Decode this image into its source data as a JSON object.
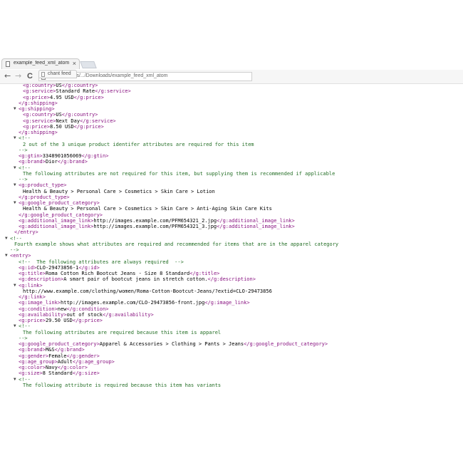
{
  "browser": {
    "tab_title": "example_feed_xml_atom",
    "close_glyph": "×",
    "back_glyph": "←",
    "forward_glyph": "→",
    "reload_glyph": "C",
    "url_fragment": "file:///C:/Users/.../Downloads/example_feed_xml_atom",
    "overlay_tab_title": "chant feed"
  },
  "xml_lines": [
    {
      "indent": 5,
      "arrow": false,
      "segs": [
        [
          "t",
          "<g:country>"
        ],
        [
          "x",
          "US"
        ],
        [
          "t",
          "</g:country>"
        ]
      ]
    },
    {
      "indent": 5,
      "arrow": false,
      "segs": [
        [
          "t",
          "<g:service>"
        ],
        [
          "x",
          "Standard Rate"
        ],
        [
          "t",
          "</g:service>"
        ]
      ]
    },
    {
      "indent": 5,
      "arrow": false,
      "segs": [
        [
          "t",
          "<g:price>"
        ],
        [
          "x",
          "4.95 USD"
        ],
        [
          "t",
          "</g:price>"
        ]
      ]
    },
    {
      "indent": 4,
      "arrow": false,
      "segs": [
        [
          "t",
          "</g:shipping>"
        ]
      ]
    },
    {
      "indent": 4,
      "arrow": true,
      "segs": [
        [
          "t",
          "<g:shipping>"
        ]
      ]
    },
    {
      "indent": 5,
      "arrow": false,
      "segs": [
        [
          "t",
          "<g:country>"
        ],
        [
          "x",
          "US"
        ],
        [
          "t",
          "</g:country>"
        ]
      ]
    },
    {
      "indent": 5,
      "arrow": false,
      "segs": [
        [
          "t",
          "<g:service>"
        ],
        [
          "x",
          "Next Day"
        ],
        [
          "t",
          "</g:service>"
        ]
      ]
    },
    {
      "indent": 5,
      "arrow": false,
      "segs": [
        [
          "t",
          "<g:price>"
        ],
        [
          "x",
          "8.50 USD"
        ],
        [
          "t",
          "</g:price>"
        ]
      ]
    },
    {
      "indent": 4,
      "arrow": false,
      "segs": [
        [
          "t",
          "</g:shipping>"
        ]
      ]
    },
    {
      "indent": 4,
      "arrow": true,
      "segs": [
        [
          "c",
          "<!--"
        ]
      ]
    },
    {
      "indent": 5,
      "arrow": false,
      "segs": [
        [
          "c",
          "2 out of the 3 unique product identifer attributes are required for this item"
        ]
      ]
    },
    {
      "indent": 4,
      "arrow": false,
      "segs": [
        [
          "c",
          "-->"
        ]
      ]
    },
    {
      "indent": 4,
      "arrow": false,
      "segs": [
        [
          "t",
          "<g:gtin>"
        ],
        [
          "x",
          "3348901056069"
        ],
        [
          "t",
          "</g:gtin>"
        ]
      ]
    },
    {
      "indent": 4,
      "arrow": false,
      "segs": [
        [
          "t",
          "<g:brand>"
        ],
        [
          "x",
          "Dior"
        ],
        [
          "t",
          "</g:brand>"
        ]
      ]
    },
    {
      "indent": 4,
      "arrow": true,
      "segs": [
        [
          "c",
          "<!--"
        ]
      ]
    },
    {
      "indent": 5,
      "arrow": false,
      "segs": [
        [
          "c",
          "The following attributes are not required for this item, but supplying them is recommended if applicable"
        ]
      ]
    },
    {
      "indent": 4,
      "arrow": false,
      "segs": [
        [
          "c",
          "-->"
        ]
      ]
    },
    {
      "indent": 4,
      "arrow": true,
      "segs": [
        [
          "t",
          "<g:product_type>"
        ]
      ]
    },
    {
      "indent": 5,
      "arrow": false,
      "segs": [
        [
          "x",
          "Health & Beauty > Personal Care > Cosmetics > Skin Care > Lotion"
        ]
      ]
    },
    {
      "indent": 4,
      "arrow": false,
      "segs": [
        [
          "t",
          "</g:product_type>"
        ]
      ]
    },
    {
      "indent": 4,
      "arrow": true,
      "segs": [
        [
          "t",
          "<g:google_product_category>"
        ]
      ]
    },
    {
      "indent": 5,
      "arrow": false,
      "segs": [
        [
          "x",
          "Health & Beauty > Personal Care > Cosmetics > Skin Care > Anti-Aging Skin Care Kits"
        ]
      ]
    },
    {
      "indent": 4,
      "arrow": false,
      "segs": [
        [
          "t",
          "</g:google_product_category>"
        ]
      ]
    },
    {
      "indent": 4,
      "arrow": false,
      "segs": [
        [
          "t",
          "<g:additional_image_link>"
        ],
        [
          "x",
          "http://images.example.com/PFM654321_2.jpg"
        ],
        [
          "t",
          "</g:additional_image_link>"
        ]
      ]
    },
    {
      "indent": 4,
      "arrow": false,
      "segs": [
        [
          "t",
          "<g:additional_image_link>"
        ],
        [
          "x",
          "http://images.example.com/PFM654321_3.jpg"
        ],
        [
          "t",
          "</g:additional_image_link>"
        ]
      ]
    },
    {
      "indent": 3,
      "arrow": false,
      "segs": [
        [
          "t",
          "</entry>"
        ]
      ]
    },
    {
      "indent": 2,
      "arrow": true,
      "segs": [
        [
          "c",
          "<!--"
        ]
      ]
    },
    {
      "indent": 3,
      "arrow": false,
      "segs": [
        [
          "c",
          "Fourth example shows what attributes are required and recommended for items that are in the apparel category"
        ]
      ]
    },
    {
      "indent": 2,
      "arrow": false,
      "segs": [
        [
          "c",
          "-->"
        ]
      ]
    },
    {
      "indent": 2,
      "arrow": true,
      "segs": [
        [
          "t",
          "<entry>"
        ]
      ]
    },
    {
      "indent": 4,
      "arrow": false,
      "segs": [
        [
          "c",
          "<!--  The following attributes are always required  -->"
        ]
      ]
    },
    {
      "indent": 4,
      "arrow": false,
      "segs": [
        [
          "t",
          "<g:id>"
        ],
        [
          "x",
          "CLO-29473856-1"
        ],
        [
          "t",
          "</g:id>"
        ]
      ]
    },
    {
      "indent": 4,
      "arrow": false,
      "segs": [
        [
          "t",
          "<g:title>"
        ],
        [
          "x",
          "Roma Cotton Rich Bootcut Jeans - Size 8 Standard"
        ],
        [
          "t",
          "</g:title>"
        ]
      ]
    },
    {
      "indent": 4,
      "arrow": false,
      "segs": [
        [
          "t",
          "<g:description>"
        ],
        [
          "x",
          "A smart pair of bootcut jeans in stretch cotton."
        ],
        [
          "t",
          "</g:description>"
        ]
      ]
    },
    {
      "indent": 4,
      "arrow": true,
      "segs": [
        [
          "t",
          "<g:link>"
        ]
      ]
    },
    {
      "indent": 5,
      "arrow": false,
      "segs": [
        [
          "x",
          "http://www.example.com/clothing/women/Roma-Cotton-Bootcut-Jeans/?extid=CLO-29473856"
        ]
      ]
    },
    {
      "indent": 4,
      "arrow": false,
      "segs": [
        [
          "t",
          "</g:link>"
        ]
      ]
    },
    {
      "indent": 4,
      "arrow": false,
      "segs": [
        [
          "t",
          "<g:image_link>"
        ],
        [
          "x",
          "http://images.example.com/CLO-29473856-front.jpg"
        ],
        [
          "t",
          "</g:image_link>"
        ]
      ]
    },
    {
      "indent": 4,
      "arrow": false,
      "segs": [
        [
          "t",
          "<g:condition>"
        ],
        [
          "x",
          "new"
        ],
        [
          "t",
          "</g:condition>"
        ]
      ]
    },
    {
      "indent": 4,
      "arrow": false,
      "segs": [
        [
          "t",
          "<g:availability>"
        ],
        [
          "x",
          "out of stock"
        ],
        [
          "t",
          "</g:availability>"
        ]
      ]
    },
    {
      "indent": 4,
      "arrow": false,
      "segs": [
        [
          "t",
          "<g:price>"
        ],
        [
          "x",
          "29.50 USD"
        ],
        [
          "t",
          "</g:price>"
        ]
      ]
    },
    {
      "indent": 4,
      "arrow": true,
      "segs": [
        [
          "c",
          "<!--"
        ]
      ]
    },
    {
      "indent": 5,
      "arrow": false,
      "segs": [
        [
          "c",
          "The following attributes are required because this item is apparel"
        ]
      ]
    },
    {
      "indent": 4,
      "arrow": false,
      "segs": [
        [
          "c",
          "-->"
        ]
      ]
    },
    {
      "indent": 4,
      "arrow": false,
      "segs": [
        [
          "t",
          "<g:google_product_category>"
        ],
        [
          "x",
          "Apparel & Accessories > Clothing > Pants > Jeans"
        ],
        [
          "t",
          "</g:google_product_category>"
        ]
      ]
    },
    {
      "indent": 4,
      "arrow": false,
      "segs": [
        [
          "t",
          "<g:brand>"
        ],
        [
          "x",
          "M&S"
        ],
        [
          "t",
          "</g:brand>"
        ]
      ]
    },
    {
      "indent": 4,
      "arrow": false,
      "segs": [
        [
          "t",
          "<g:gender>"
        ],
        [
          "x",
          "Female"
        ],
        [
          "t",
          "</g:gender>"
        ]
      ]
    },
    {
      "indent": 4,
      "arrow": false,
      "segs": [
        [
          "t",
          "<g:age_group>"
        ],
        [
          "x",
          "Adult"
        ],
        [
          "t",
          "</g:age_group>"
        ]
      ]
    },
    {
      "indent": 4,
      "arrow": false,
      "segs": [
        [
          "t",
          "<g:color>"
        ],
        [
          "x",
          "Navy"
        ],
        [
          "t",
          "</g:color>"
        ]
      ]
    },
    {
      "indent": 4,
      "arrow": false,
      "segs": [
        [
          "t",
          "<g:size>"
        ],
        [
          "x",
          "8 Standard"
        ],
        [
          "t",
          "</g:size>"
        ]
      ]
    },
    {
      "indent": 4,
      "arrow": true,
      "segs": [
        [
          "c",
          "<!--"
        ]
      ]
    },
    {
      "indent": 5,
      "arrow": false,
      "segs": [
        [
          "c",
          "The following attribute is required because this item has variants"
        ]
      ]
    }
  ]
}
